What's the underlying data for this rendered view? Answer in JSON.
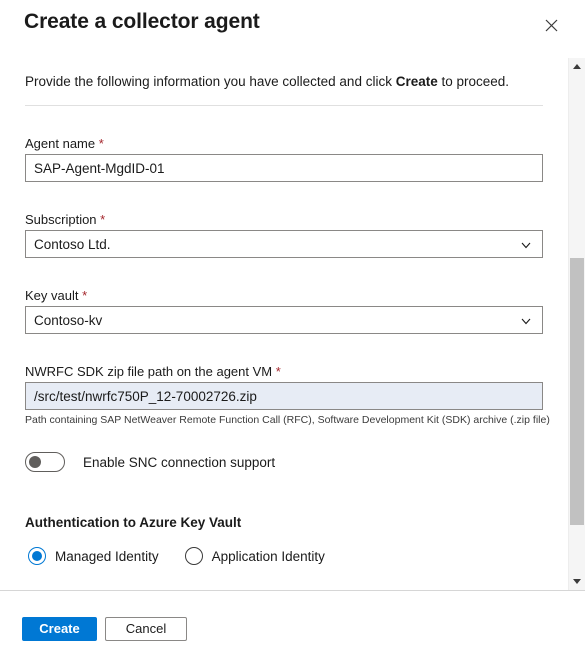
{
  "header": {
    "title": "Create a collector agent",
    "close_icon": "close-icon"
  },
  "intro": {
    "prefix": "Provide the following information you have collected and click ",
    "emphasis": "Create",
    "suffix": " to proceed."
  },
  "form": {
    "agent_name": {
      "label": "Agent name",
      "required_marker": "*",
      "value": "SAP-Agent-MgdID-01",
      "placeholder": ""
    },
    "subscription": {
      "label": "Subscription",
      "required_marker": "*",
      "value": "Contoso Ltd.",
      "chevron_icon": "chevron-down-icon"
    },
    "key_vault": {
      "label": "Key vault",
      "required_marker": "*",
      "value": "Contoso-kv",
      "chevron_icon": "chevron-down-icon"
    },
    "nwrfc_path": {
      "label": "NWRFC SDK zip file path on the agent VM",
      "required_marker": "*",
      "value": "/src/test/nwrfc750P_12-70002726.zip",
      "placeholder": "",
      "helper": "Path containing SAP NetWeaver Remote Function Call (RFC), Software Development Kit (SDK) archive (.zip file)"
    },
    "snc_toggle": {
      "label": "Enable SNC connection support",
      "state": "off"
    }
  },
  "auth_section": {
    "title": "Authentication to Azure Key Vault",
    "options": [
      {
        "label": "Managed Identity",
        "selected": true
      },
      {
        "label": "Application Identity",
        "selected": false
      }
    ]
  },
  "footer": {
    "create_label": "Create",
    "cancel_label": "Cancel"
  },
  "scrollbar": {
    "up_icon": "scroll-up-arrow-icon",
    "down_icon": "scroll-down-arrow-icon"
  },
  "colors": {
    "accent": "#0078d4",
    "required_asterisk": "#a4262c",
    "input_border": "#8a8886",
    "focused_input_bg": "#e7ecf5",
    "scrollbar_thumb": "#c1c1c1",
    "text": "#1b1b1b"
  }
}
